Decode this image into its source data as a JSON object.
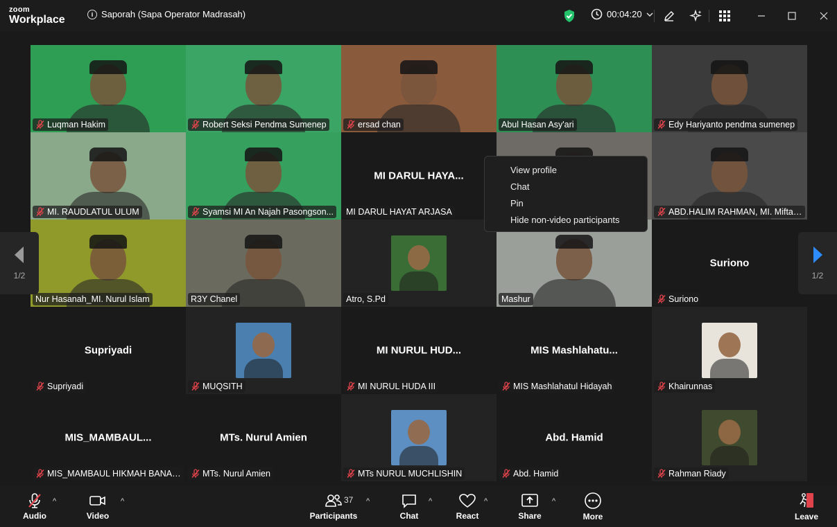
{
  "app": {
    "logo_line1": "zoom",
    "logo_line2": "Workplace"
  },
  "meeting": {
    "title": "Saporah (Sapa Operator Madrasah)",
    "timer": "00:04:20"
  },
  "pager": {
    "left_page": "1/2",
    "right_page": "1/2"
  },
  "tiles": [
    {
      "name": "Luqman Hakim",
      "big": "",
      "row": 0,
      "col": 0,
      "kind": "video",
      "bg": "#2f9e55"
    },
    {
      "name": "Robert Seksi Pendma Sumenep",
      "big": "",
      "row": 0,
      "col": 1,
      "kind": "video",
      "bg": "#3aa565"
    },
    {
      "name": "ersad chan",
      "big": "",
      "row": 0,
      "col": 2,
      "kind": "video",
      "bg": "#8a5a3c"
    },
    {
      "name": "Abul Hasan Asy'ari",
      "big": "",
      "row": 0,
      "col": 3,
      "kind": "video",
      "bg": "#2e8f55"
    },
    {
      "name": "Edy Hariyanto pendma sumenep",
      "big": "",
      "row": 0,
      "col": 4,
      "kind": "video",
      "bg": "#3b3b3b"
    },
    {
      "name": "MI. RAUDLATUL ULUM",
      "big": "",
      "row": 1,
      "col": 0,
      "kind": "video",
      "bg": "#8aa88a"
    },
    {
      "name": "Syamsi MI An Najah Pasongson...",
      "big": "",
      "row": 1,
      "col": 1,
      "kind": "video",
      "bg": "#36a05e"
    },
    {
      "name": "MI DARUL HAYAT ARJASA",
      "big": "MI DARUL HAYA...",
      "row": 1,
      "col": 2,
      "kind": "novideo",
      "bg": "#1a1a1a"
    },
    {
      "name": "",
      "big": "",
      "row": 1,
      "col": 3,
      "kind": "video",
      "bg": "#6e6a66"
    },
    {
      "name": "ABD.HALIM RAHMAN, MI. Miftah...",
      "big": "",
      "row": 1,
      "col": 4,
      "kind": "video",
      "bg": "#4a4a4a"
    },
    {
      "name": "Nur Hasanah_MI. Nurul Islam",
      "big": "",
      "row": 2,
      "col": 0,
      "kind": "video",
      "bg": "#8f9a2a",
      "active": true
    },
    {
      "name": "R3Y Chanel",
      "big": "",
      "row": 2,
      "col": 1,
      "kind": "video",
      "bg": "#6a6a5e"
    },
    {
      "name": "Atro, S.Pd",
      "big": "",
      "row": 2,
      "col": 2,
      "kind": "avatar",
      "bg": "#3a6d35"
    },
    {
      "name": "Mashur",
      "big": "",
      "row": 2,
      "col": 3,
      "kind": "video",
      "bg": "#9a9f9a"
    },
    {
      "name": "Suriono",
      "big": "Suriono",
      "row": 2,
      "col": 4,
      "kind": "novideo",
      "bg": "#1a1a1a"
    },
    {
      "name": "Supriyadi",
      "big": "Supriyadi",
      "row": 3,
      "col": 0,
      "kind": "novideo",
      "bg": "#1a1a1a"
    },
    {
      "name": "MUQSITH",
      "big": "",
      "row": 3,
      "col": 1,
      "kind": "avatar",
      "bg": "#4a7fb0"
    },
    {
      "name": "MI NURUL HUDA III",
      "big": "MI  NURUL HUD...",
      "row": 3,
      "col": 2,
      "kind": "novideo",
      "bg": "#1a1a1a"
    },
    {
      "name": "MIS Mashlahatul Hidayah",
      "big": "MIS  Mashlahatu...",
      "row": 3,
      "col": 3,
      "kind": "novideo",
      "bg": "#1a1a1a"
    },
    {
      "name": "Khairunnas",
      "big": "",
      "row": 3,
      "col": 4,
      "kind": "avatar",
      "bg": "#e8e4dc"
    },
    {
      "name": "MIS_MAMBAUL HIKMAH BANAS...",
      "big": "MIS_MAMBAUL...",
      "row": 4,
      "col": 0,
      "kind": "novideo",
      "bg": "#1a1a1a"
    },
    {
      "name": "MTs. Nurul Amien",
      "big": "MTs. Nurul Amien",
      "row": 4,
      "col": 1,
      "kind": "novideo",
      "bg": "#1a1a1a"
    },
    {
      "name": "MTs NURUL MUCHLISHIN",
      "big": "",
      "row": 4,
      "col": 2,
      "kind": "avatar",
      "bg": "#5d8fc2"
    },
    {
      "name": "Abd. Hamid",
      "big": "Abd. Hamid",
      "row": 4,
      "col": 3,
      "kind": "novideo",
      "bg": "#1a1a1a"
    },
    {
      "name": "Rahman Riady",
      "big": "",
      "row": 4,
      "col": 4,
      "kind": "avatar",
      "bg": "#3f4a2e"
    }
  ],
  "context_menu": [
    "View profile",
    "Chat",
    "Pin",
    "Hide non-video participants"
  ],
  "toolbar": {
    "audio": "Audio",
    "video": "Video",
    "participants": "Participants",
    "participants_count": "37",
    "chat": "Chat",
    "react": "React",
    "share": "Share",
    "more": "More",
    "leave": "Leave"
  },
  "colors": {
    "accent_green": "#3ed17e",
    "muted_red": "#e0434b",
    "pager_blue": "#2d8cff"
  }
}
